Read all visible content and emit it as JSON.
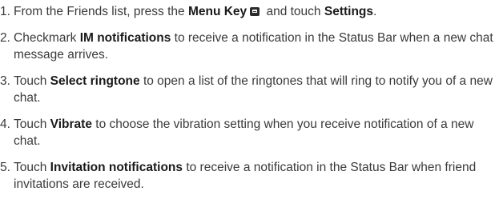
{
  "steps": [
    {
      "number": "1.",
      "parts": {
        "t1": "From the Friends list, press the ",
        "b1": "Menu Key",
        "icon": "menu-key-icon",
        "t2": " and touch ",
        "b2": "Settings",
        "t3": "."
      }
    },
    {
      "number": "2.",
      "parts": {
        "t1": "Checkmark ",
        "b1": "IM notifications",
        "t2": " to receive a notification in the Status Bar when a new chat message arrives."
      }
    },
    {
      "number": "3.",
      "parts": {
        "t1": "Touch ",
        "b1": "Select ringtone",
        "t2": " to open a list of the ringtones that will ring to notify you of a new chat."
      }
    },
    {
      "number": "4.",
      "parts": {
        "t1": "Touch ",
        "b1": "Vibrate",
        "t2": " to choose the vibration setting when you receive notification of a new chat."
      }
    },
    {
      "number": "5.",
      "parts": {
        "t1": "Touch ",
        "b1": "Invitation notifications",
        "t2": " to receive a notification in the Status Bar when friend invitations are received."
      }
    }
  ]
}
